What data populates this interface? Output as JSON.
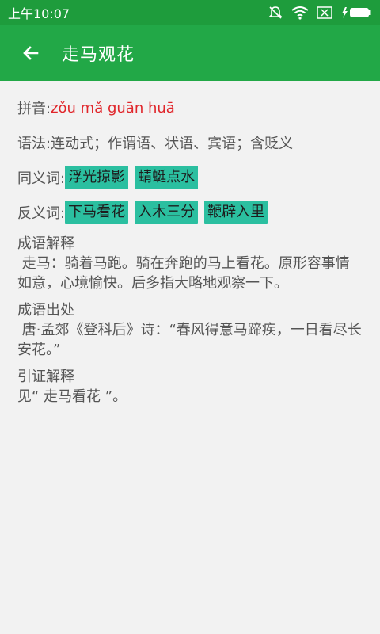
{
  "status_bar": {
    "time": "上午10:07",
    "icons": [
      "mute-icon",
      "wifi-icon",
      "sim-off-icon",
      "battery-charging-icon"
    ]
  },
  "app_bar": {
    "title": "走马观花",
    "back_icon": "arrow-left-icon"
  },
  "idiom": {
    "pinyin_label": "拼音: ",
    "pinyin": "zǒu mǎ guān huā",
    "grammar_label": "语法: ",
    "grammar": "连动式；作谓语、状语、宾语；含贬义",
    "synonyms_label": "同义词: ",
    "synonyms": [
      "浮光掠影",
      "蜻蜓点水"
    ],
    "antonyms_label": "反义词: ",
    "antonyms": [
      "下马看花",
      "入木三分",
      "鞭辟入里"
    ],
    "sections": {
      "explanation": {
        "title": "成语解释",
        "body": " 走马：骑着马跑。骑在奔跑的马上看花。原形容事情如意，心境愉快。后多指大略地观察一下。"
      },
      "origin": {
        "title": "成语出处",
        "body": " 唐·孟郊《登科后》诗：“春风得意马蹄疾，一日看尽长安花。”"
      },
      "citation": {
        "title": "引证解释",
        "body": "见“ 走马看花 ”。"
      }
    }
  },
  "colors": {
    "status_bar": "#1e9c3c",
    "app_bar": "#22a847",
    "pinyin": "#e0262b",
    "tag_bg": "#2bbfa0",
    "background": "#f2f2f2"
  }
}
